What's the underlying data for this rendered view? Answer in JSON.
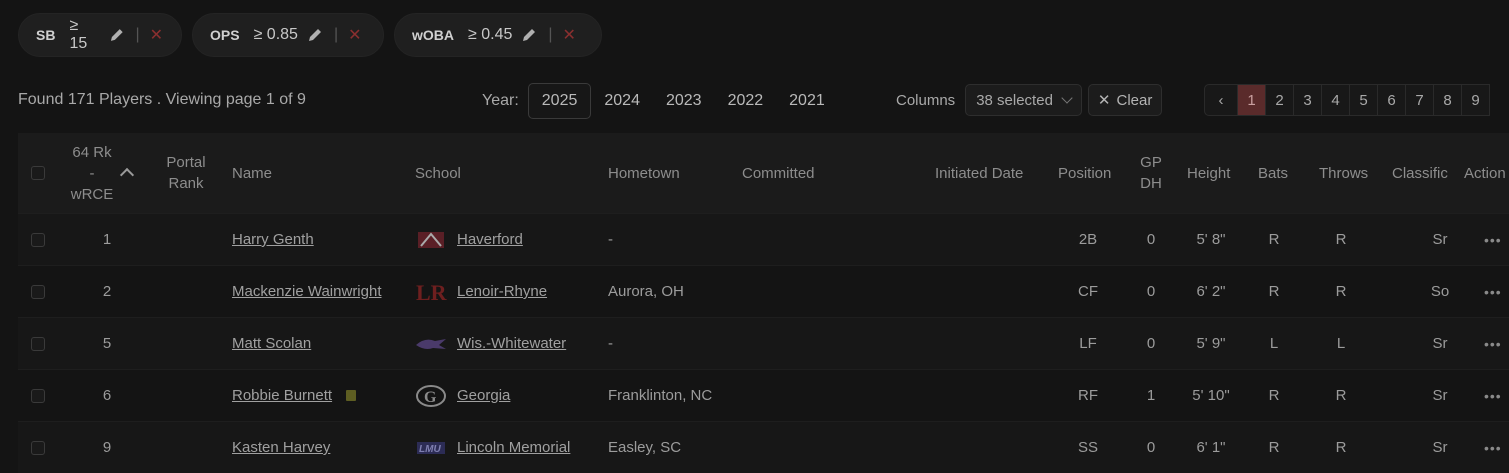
{
  "filters": [
    {
      "metric": "SB",
      "condition": "≥ 15"
    },
    {
      "metric": "OPS",
      "condition": "≥ 0.85"
    },
    {
      "metric": "wOBA",
      "condition": "≥ 0.45"
    }
  ],
  "summary": "Found 171 Players . Viewing page 1 of 9",
  "year_filter": {
    "label": "Year:",
    "options": [
      "2025",
      "2024",
      "2023",
      "2022",
      "2021"
    ],
    "selected": "2025"
  },
  "columns_control": {
    "label": "Columns",
    "value": "38 selected",
    "clear_label": "Clear"
  },
  "pagination": {
    "prev": "‹",
    "pages": [
      "1",
      "2",
      "3",
      "4",
      "5",
      "6",
      "7",
      "8",
      "9"
    ],
    "current": "1"
  },
  "table": {
    "headers": {
      "rank_line1": "64 Rk",
      "rank_line2": "-",
      "rank_line3": "wRCE",
      "portal_line1": "Portal",
      "portal_line2": "Rank",
      "name": "Name",
      "school": "School",
      "hometown": "Hometown",
      "committed": "Committed",
      "initiated": "Initiated Date",
      "position": "Position",
      "gp_line1": "GP",
      "gp_line2": "DH",
      "height": "Height",
      "bats": "Bats",
      "throws": "Throws",
      "classification": "Classific",
      "actions": "Action"
    },
    "rows": [
      {
        "rank": "1",
        "name": "Harry Genth",
        "school": "Haverford",
        "hometown": "-",
        "position": "2B",
        "gpdh": "0",
        "height": "5' 8\"",
        "bats": "R",
        "throws": "R",
        "class": "Sr",
        "actions": "•••"
      },
      {
        "rank": "2",
        "name": "Mackenzie Wainwright",
        "school": "Lenoir-Rhyne",
        "hometown": "Aurora, OH",
        "position": "CF",
        "gpdh": "0",
        "height": "6' 2\"",
        "bats": "R",
        "throws": "R",
        "class": "So",
        "actions": "•••"
      },
      {
        "rank": "5",
        "name": "Matt Scolan",
        "school": "Wis.-Whitewater",
        "hometown": "-",
        "position": "LF",
        "gpdh": "0",
        "height": "5' 9\"",
        "bats": "L",
        "throws": "L",
        "class": "Sr",
        "actions": "•••"
      },
      {
        "rank": "6",
        "name": "Robbie Burnett",
        "school": "Georgia",
        "hometown": "Franklinton, NC",
        "position": "RF",
        "gpdh": "1",
        "height": "5' 10\"",
        "bats": "R",
        "throws": "R",
        "class": "Sr",
        "actions": "•••"
      },
      {
        "rank": "9",
        "name": "Kasten Harvey",
        "school": "Lincoln Memorial",
        "hometown": "Easley, SC",
        "position": "SS",
        "gpdh": "0",
        "height": "6' 1\"",
        "bats": "R",
        "throws": "R",
        "class": "Sr",
        "actions": "•••"
      }
    ]
  },
  "colors": {
    "background": "#141414",
    "active_page": "#5a2b2b",
    "remove_x": "#8a2f2f"
  }
}
